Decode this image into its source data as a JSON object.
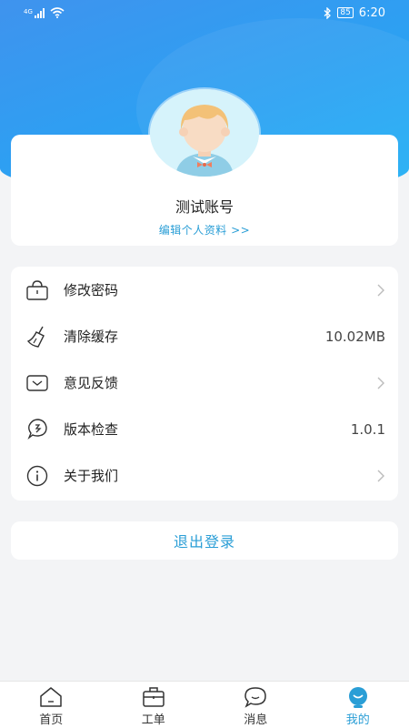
{
  "status_bar": {
    "network_label": "4G",
    "battery": "85",
    "time": "6:20"
  },
  "profile": {
    "account_name": "测试账号",
    "edit_link": "编辑个人资料 >>"
  },
  "menu": {
    "items": [
      {
        "label": "修改密码",
        "icon": "lock-icon",
        "value": "",
        "chevron": true
      },
      {
        "label": "清除缓存",
        "icon": "broom-icon",
        "value": "10.02MB",
        "chevron": false
      },
      {
        "label": "意见反馈",
        "icon": "feedback-icon",
        "value": "",
        "chevron": true
      },
      {
        "label": "版本检查",
        "icon": "version-icon",
        "value": "1.0.1",
        "chevron": false
      },
      {
        "label": "关于我们",
        "icon": "info-icon",
        "value": "",
        "chevron": true
      }
    ]
  },
  "logout": {
    "label": "退出登录"
  },
  "tabbar": {
    "tabs": [
      {
        "label": "首页",
        "icon": "home-icon",
        "active": false
      },
      {
        "label": "工单",
        "icon": "briefcase-icon",
        "active": false
      },
      {
        "label": "消息",
        "icon": "message-icon",
        "active": false
      },
      {
        "label": "我的",
        "icon": "profile-icon",
        "active": true
      }
    ]
  },
  "colors": {
    "accent": "#2a9ed6",
    "header_start": "#3f93ee",
    "header_end": "#1fb0f5",
    "background": "#f3f4f6"
  }
}
